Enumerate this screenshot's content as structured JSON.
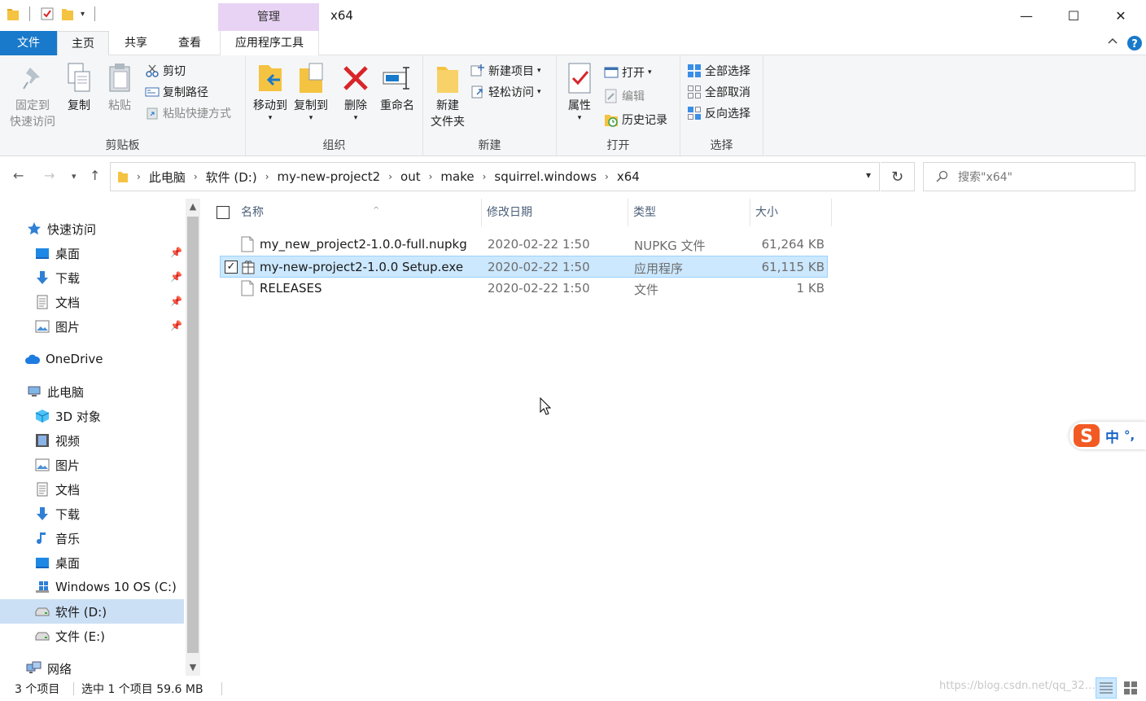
{
  "window": {
    "title": "x64",
    "context_tab_group": "管理",
    "controls": {
      "minimize": "—",
      "maximize": "☐",
      "close": "✕"
    }
  },
  "tabs": {
    "file": "文件",
    "home": "主页",
    "share": "共享",
    "view": "查看",
    "app_tools": "应用程序工具"
  },
  "ribbon": {
    "clipboard": {
      "label": "剪贴板",
      "pin": "固定到快速访问",
      "pin_line1": "固定到",
      "pin_line2": "快速访问",
      "copy": "复制",
      "paste": "粘贴",
      "cut": "剪切",
      "copy_path": "复制路径",
      "paste_shortcut": "粘贴快捷方式"
    },
    "organize": {
      "label": "组织",
      "move_to": "移动到",
      "copy_to": "复制到",
      "delete": "删除",
      "rename": "重命名"
    },
    "new": {
      "label": "新建",
      "new_folder_line1": "新建",
      "new_folder_line2": "文件夹",
      "new_item": "新建项目",
      "easy_access": "轻松访问"
    },
    "open": {
      "label": "打开",
      "properties": "属性",
      "open": "打开",
      "edit": "编辑",
      "history": "历史记录"
    },
    "select": {
      "label": "选择",
      "select_all": "全部选择",
      "select_none": "全部取消",
      "invert": "反向选择"
    }
  },
  "address": {
    "crumbs": [
      "此电脑",
      "软件 (D:)",
      "my-new-project2",
      "out",
      "make",
      "squirrel.windows",
      "x64"
    ],
    "search_placeholder": "搜索\"x64\""
  },
  "nav": {
    "quick_access": "快速访问",
    "qa_items": [
      "桌面",
      "下载",
      "文档",
      "图片"
    ],
    "onedrive": "OneDrive",
    "this_pc": "此电脑",
    "pc_items": [
      "3D 对象",
      "视频",
      "图片",
      "文档",
      "下载",
      "音乐",
      "桌面",
      "Windows 10 OS (C:)",
      "软件 (D:)",
      "文件 (E:)"
    ],
    "network": "网络"
  },
  "columns": {
    "name": "名称",
    "modified": "修改日期",
    "type": "类型",
    "size": "大小"
  },
  "files": [
    {
      "name": "my_new_project2-1.0.0-full.nupkg",
      "modified": "2020-02-22 1:50",
      "type": "NUPKG 文件",
      "size": "61,264 KB",
      "selected": false
    },
    {
      "name": "my-new-project2-1.0.0 Setup.exe",
      "modified": "2020-02-22 1:50",
      "type": "应用程序",
      "size": "61,115 KB",
      "selected": true
    },
    {
      "name": "RELEASES",
      "modified": "2020-02-22 1:50",
      "type": "文件",
      "size": "1 KB",
      "selected": false
    }
  ],
  "status": {
    "count": "3 个项目",
    "selection": "选中 1 个项目  59.6 MB"
  },
  "ime": {
    "mode": "中",
    "punct": "°,"
  },
  "watermark": "https://blog.csdn.net/qq_32…",
  "colors": {
    "accent": "#1979ca",
    "selection": "#cce8ff",
    "context_tab": "#e8d3f5",
    "folder": "#f5c342",
    "delete_red": "#d8252a"
  }
}
